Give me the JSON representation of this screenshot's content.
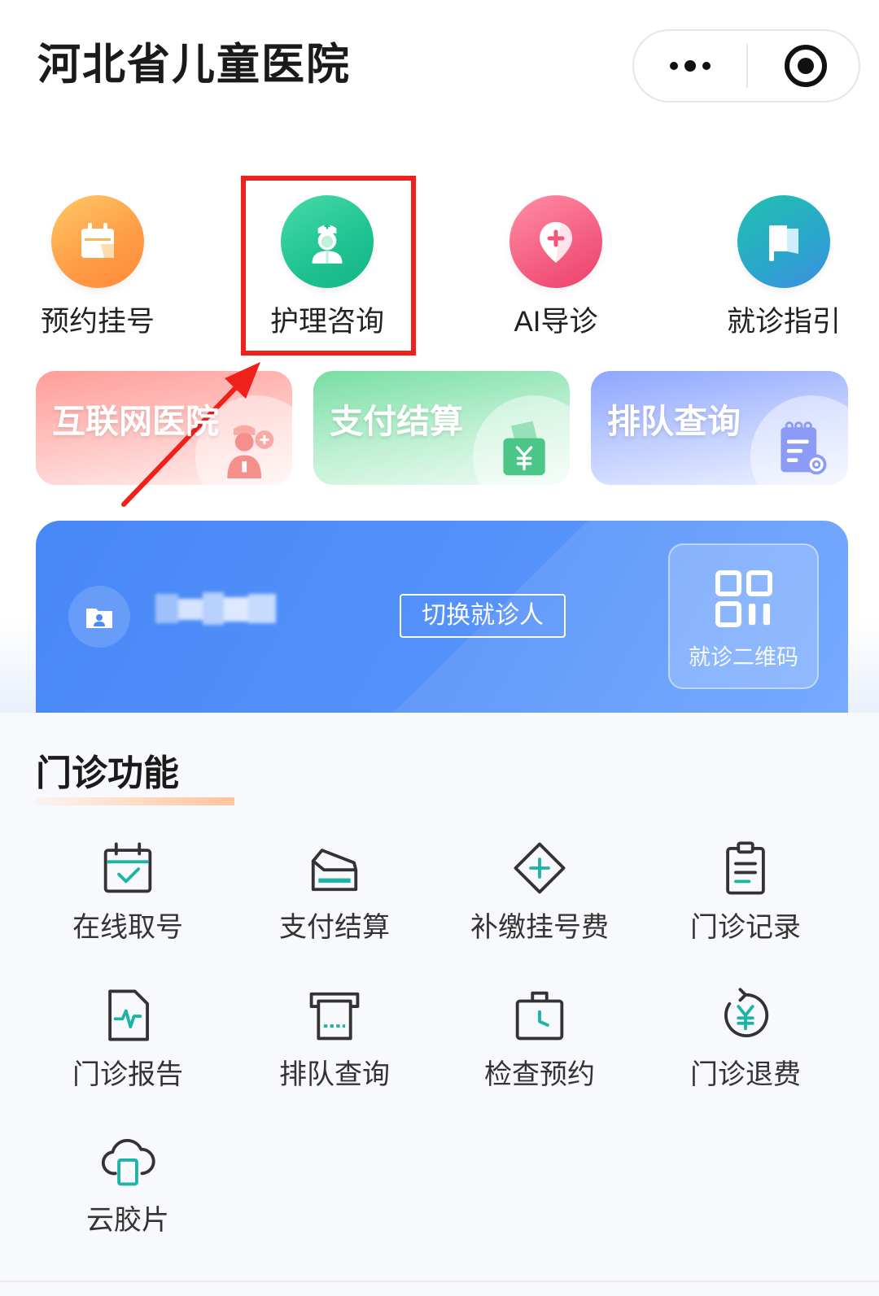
{
  "header": {
    "title": "河北省儿童医院",
    "more_icon": "more-dots-icon",
    "target_icon": "target-icon"
  },
  "quick_actions": [
    {
      "label": "预约挂号",
      "icon": "calendar-icon",
      "color": "#ff9b45"
    },
    {
      "label": "护理咨询",
      "icon": "nurse-icon",
      "color": "#1fc291"
    },
    {
      "label": "AI导诊",
      "icon": "location-plus-icon",
      "color": "#f45d80"
    },
    {
      "label": "就诊指引",
      "icon": "flag-icon",
      "color": "#2ba6cc"
    }
  ],
  "annotation": {
    "color": "#f0201a"
  },
  "service_cards": [
    {
      "label": "互联网医院",
      "icon": "doctor-icon",
      "color": "#ff9d9a"
    },
    {
      "label": "支付结算",
      "icon": "wallet-yen-icon",
      "color": "#78dea3"
    },
    {
      "label": "排队查询",
      "icon": "queue-search-icon",
      "color": "#8ea6ff"
    }
  ],
  "patient_card": {
    "avatar_icon": "patient-folder-icon",
    "switch_label": "切换就诊人",
    "qr_icon": "qr-code-icon",
    "qr_label": "就诊二维码"
  },
  "outpatient": {
    "title": "门诊功能",
    "items": [
      {
        "label": "在线取号",
        "icon": "calendar-check-icon"
      },
      {
        "label": "支付结算",
        "icon": "payment-tray-icon"
      },
      {
        "label": "补缴挂号费",
        "icon": "diamond-plus-icon"
      },
      {
        "label": "门诊记录",
        "icon": "clipboard-icon"
      },
      {
        "label": "门诊报告",
        "icon": "report-pulse-icon"
      },
      {
        "label": "排队查询",
        "icon": "ticket-machine-icon"
      },
      {
        "label": "检查预约",
        "icon": "briefcase-clock-icon"
      },
      {
        "label": "门诊退费",
        "icon": "refund-yen-icon"
      },
      {
        "label": "云胶片",
        "icon": "cloud-film-icon"
      }
    ]
  },
  "colors": {
    "accent": "#1db3a6",
    "text": "#1a1a1a",
    "card_blue": "#4a8cf7",
    "annotation": "#f0201a"
  }
}
